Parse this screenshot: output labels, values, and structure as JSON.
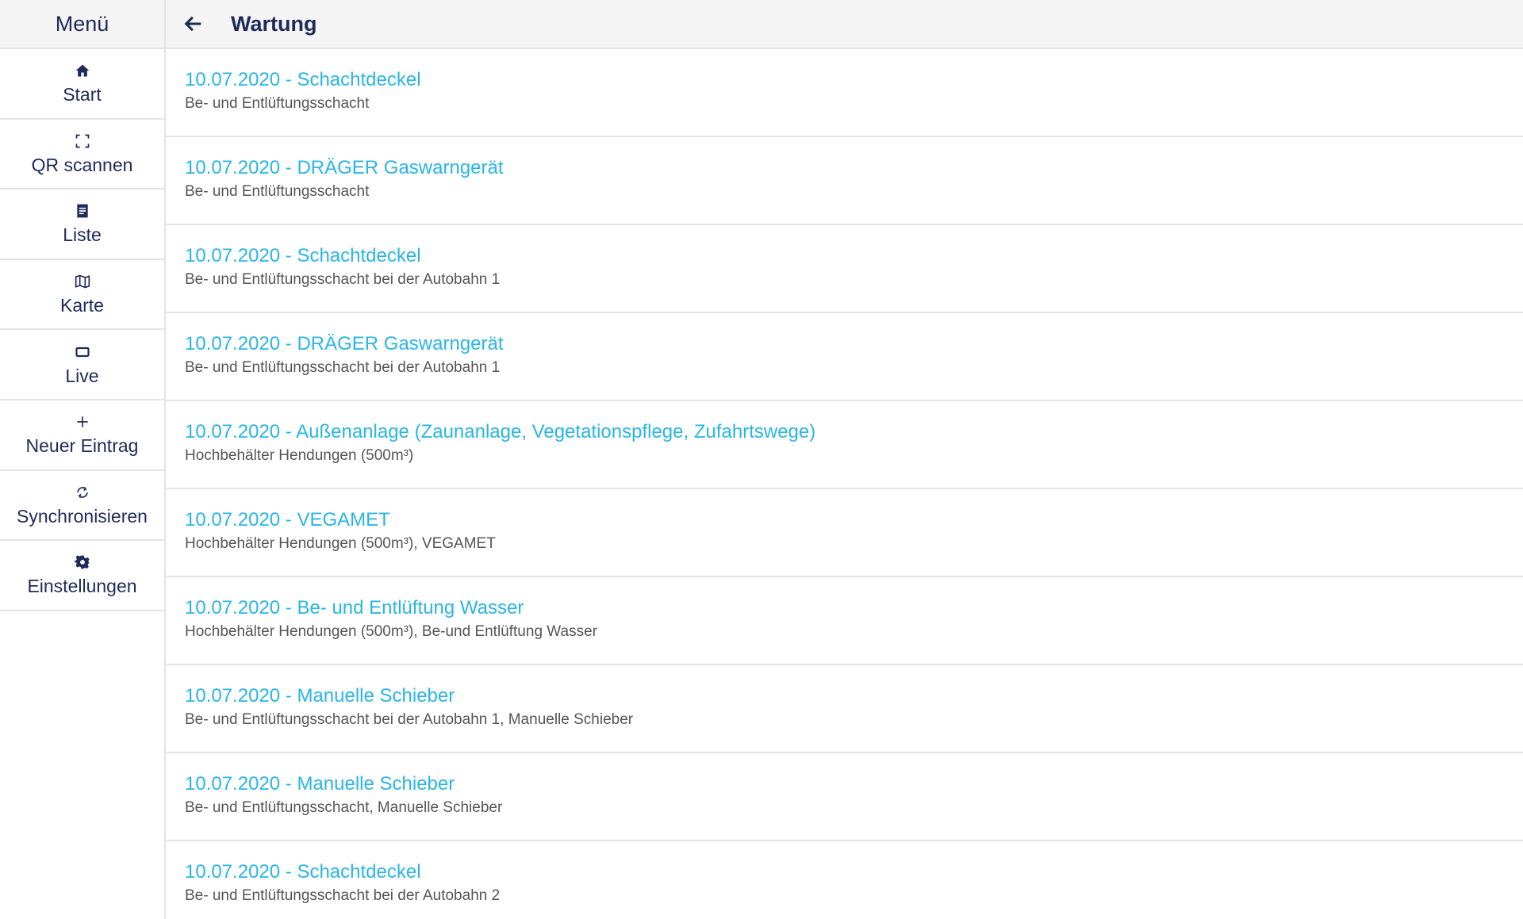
{
  "sidebar": {
    "title": "Menü",
    "items": [
      {
        "label": "Start",
        "icon": "home-icon"
      },
      {
        "label": "QR scannen",
        "icon": "qr-scan-icon"
      },
      {
        "label": "Liste",
        "icon": "list-icon"
      },
      {
        "label": "Karte",
        "icon": "map-icon"
      },
      {
        "label": "Live",
        "icon": "live-icon"
      },
      {
        "label": "Neuer Eintrag",
        "icon": "plus-icon"
      },
      {
        "label": "Synchronisieren",
        "icon": "sync-icon"
      },
      {
        "label": "Einstellungen",
        "icon": "gear-icon"
      }
    ]
  },
  "header": {
    "title": "Wartung",
    "back_icon": "arrow-left-icon"
  },
  "entries": [
    {
      "title": "10.07.2020 - Schachtdeckel",
      "subtitle": "Be- und Entlüftungsschacht"
    },
    {
      "title": "10.07.2020 - DRÄGER Gaswarngerät",
      "subtitle": "Be- und Entlüftungsschacht"
    },
    {
      "title": "10.07.2020 - Schachtdeckel",
      "subtitle": "Be- und Entlüftungsschacht bei der Autobahn 1"
    },
    {
      "title": "10.07.2020 - DRÄGER Gaswarngerät",
      "subtitle": "Be- und Entlüftungsschacht bei der Autobahn 1"
    },
    {
      "title": "10.07.2020 - Außenanlage (Zaunanlage, Vegetationspflege, Zufahrtswege)",
      "subtitle": "Hochbehälter Hendungen (500m³)"
    },
    {
      "title": "10.07.2020 - VEGAMET",
      "subtitle": "Hochbehälter Hendungen (500m³), VEGAMET"
    },
    {
      "title": "10.07.2020 - Be- und Entlüftung Wasser",
      "subtitle": "Hochbehälter Hendungen (500m³), Be-und Entlüftung Wasser"
    },
    {
      "title": "10.07.2020 - Manuelle Schieber",
      "subtitle": "Be- und Entlüftungsschacht bei der Autobahn 1, Manuelle Schieber"
    },
    {
      "title": "10.07.2020 - Manuelle Schieber",
      "subtitle": "Be- und Entlüftungsschacht, Manuelle Schieber"
    },
    {
      "title": "10.07.2020 - Schachtdeckel",
      "subtitle": "Be- und Entlüftungsschacht bei der Autobahn 2"
    }
  ],
  "colors": {
    "accent": "#29b6e4",
    "text_dark": "#1f2a5a",
    "text_muted": "#555555",
    "header_bg": "#f4f4f4",
    "divider": "#e4e4e4"
  }
}
